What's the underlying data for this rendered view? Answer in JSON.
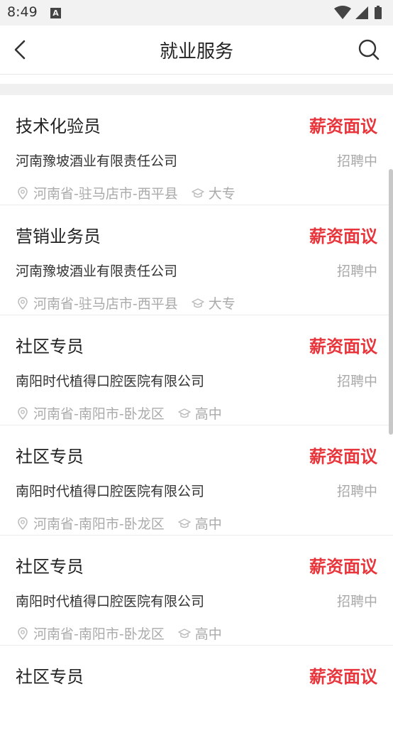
{
  "status_bar": {
    "time": "8:49",
    "notification_badge": "A"
  },
  "header": {
    "title": "就业服务"
  },
  "jobs": [
    {
      "title": "技术化验员",
      "salary": "薪资面议",
      "company": "河南豫坡酒业有限责任公司",
      "status": "招聘中",
      "location": "河南省-驻马店市-西平县",
      "education": "大专"
    },
    {
      "title": "营销业务员",
      "salary": "薪资面议",
      "company": "河南豫坡酒业有限责任公司",
      "status": "招聘中",
      "location": "河南省-驻马店市-西平县",
      "education": "大专"
    },
    {
      "title": "社区专员",
      "salary": "薪资面议",
      "company": "南阳时代植得口腔医院有限公司",
      "status": "招聘中",
      "location": "河南省-南阳市-卧龙区",
      "education": "高中"
    },
    {
      "title": "社区专员",
      "salary": "薪资面议",
      "company": "南阳时代植得口腔医院有限公司",
      "status": "招聘中",
      "location": "河南省-南阳市-卧龙区",
      "education": "高中"
    },
    {
      "title": "社区专员",
      "salary": "薪资面议",
      "company": "南阳时代植得口腔医院有限公司",
      "status": "招聘中",
      "location": "河南省-南阳市-卧龙区",
      "education": "高中"
    },
    {
      "title": "社区专员",
      "salary": "薪资面议",
      "company": "",
      "status": "",
      "location": "",
      "education": ""
    }
  ],
  "icons": {
    "back": "chevron-left-icon",
    "search": "search-icon",
    "location": "location-pin-icon",
    "education": "graduation-cap-icon"
  },
  "colors": {
    "salary": "#e8353b",
    "muted": "#aaaaaa",
    "band": "#f0f0f0"
  }
}
